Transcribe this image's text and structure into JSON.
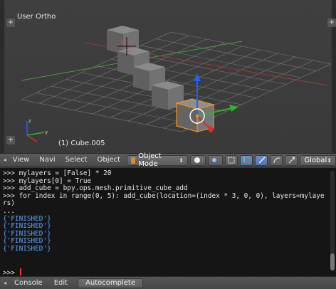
{
  "viewport": {
    "view_label": "User Ortho",
    "active_object": "(1) Cube.005"
  },
  "header": {
    "menus": [
      "View",
      "Navi",
      "Select",
      "Object"
    ],
    "mode": "Object Mode",
    "orientation": "Global"
  },
  "console": {
    "lines": [
      {
        "text": ">>> mylayers = [False] * 20",
        "kind": "input"
      },
      {
        "text": ">>> mylayers[0] = True",
        "kind": "input"
      },
      {
        "text": ">>> add_cube = bpy.ops.mesh.primitive_cube_add",
        "kind": "input"
      },
      {
        "text": ">>> for index in range(0, 5): add_cube(location=(index * 3, 0, 0), layers=mylaye",
        "kind": "input"
      },
      {
        "text": "rs)",
        "kind": "input"
      },
      {
        "text": "...",
        "kind": "input"
      },
      {
        "text": "{'FINISHED'}",
        "kind": "output"
      },
      {
        "text": "{'FINISHED'}",
        "kind": "output"
      },
      {
        "text": "{'FINISHED'}",
        "kind": "output"
      },
      {
        "text": "{'FINISHED'}",
        "kind": "output"
      },
      {
        "text": "{'FINISHED'}",
        "kind": "output"
      }
    ],
    "prompt": ">>> "
  },
  "footer": {
    "menus": [
      "Console",
      "Edit"
    ],
    "autocomplete_label": "Autocomplete"
  },
  "colors": {
    "output_text": "#5da2ff",
    "selection_outline": "#f0901e",
    "cursor": "#ff3030",
    "x_axis": "#d03030",
    "y_axis": "#30b030",
    "z_axis": "#2060ff"
  },
  "icons": [
    "plus-icon",
    "mode-cube-icon",
    "viewport-shading-icon",
    "pivot-icon",
    "manipulator-icon",
    "translate-icon",
    "rotate-icon",
    "scale-icon"
  ]
}
